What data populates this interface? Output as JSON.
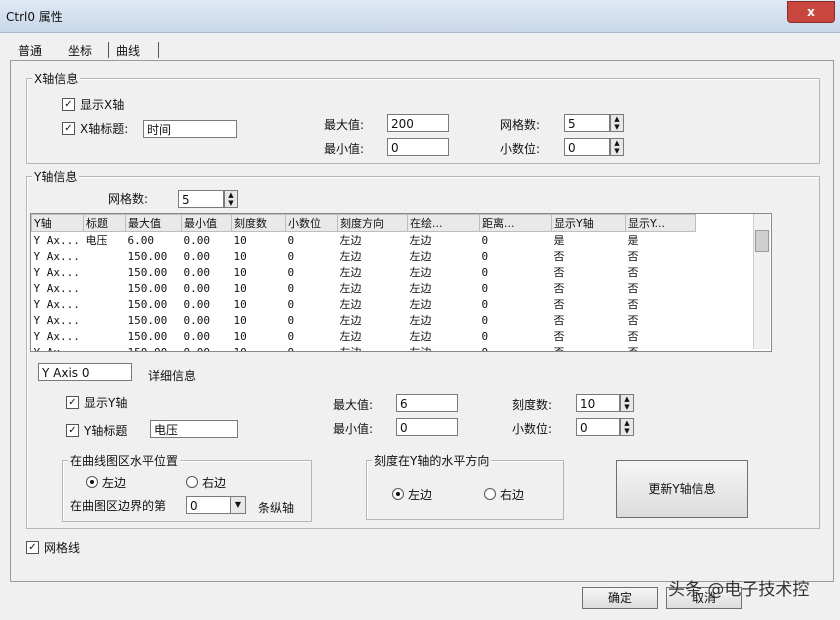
{
  "window": {
    "title": "Ctrl0 属性",
    "close_glyph": "x"
  },
  "tabs": [
    "普通",
    "坐标",
    "曲线"
  ],
  "x_axis": {
    "group_title": "X轴信息",
    "show_label": "显示X轴",
    "title_label": "X轴标题:",
    "title_value": "时间",
    "max_label": "最大值:",
    "max_value": "200",
    "min_label": "最小值:",
    "min_value": "0",
    "grid_label": "网格数:",
    "grid_value": "5",
    "decimals_label": "小数位:",
    "decimals_value": "0"
  },
  "y_axis": {
    "group_title": "Y轴信息",
    "grid_label": "网格数:",
    "grid_value": "5",
    "columns": [
      "Y轴",
      "标题",
      "最大值",
      "最小值",
      "刻度数",
      "小数位",
      "刻度方向",
      "在绘...",
      "距离...",
      "显示Y轴",
      "显示Y..."
    ],
    "rows": [
      [
        "Y Ax...",
        "电压",
        "6.00",
        "0.00",
        "10",
        "0",
        "左边",
        "左边",
        "0",
        "是",
        "是"
      ],
      [
        "Y Ax...",
        "",
        "150.00",
        "0.00",
        "10",
        "0",
        "左边",
        "左边",
        "0",
        "否",
        "否"
      ],
      [
        "Y Ax...",
        "",
        "150.00",
        "0.00",
        "10",
        "0",
        "左边",
        "左边",
        "0",
        "否",
        "否"
      ],
      [
        "Y Ax...",
        "",
        "150.00",
        "0.00",
        "10",
        "0",
        "左边",
        "左边",
        "0",
        "否",
        "否"
      ],
      [
        "Y Ax...",
        "",
        "150.00",
        "0.00",
        "10",
        "0",
        "左边",
        "左边",
        "0",
        "否",
        "否"
      ],
      [
        "Y Ax...",
        "",
        "150.00",
        "0.00",
        "10",
        "0",
        "左边",
        "左边",
        "0",
        "否",
        "否"
      ],
      [
        "Y Ax...",
        "",
        "150.00",
        "0.00",
        "10",
        "0",
        "左边",
        "左边",
        "0",
        "否",
        "否"
      ],
      [
        "Y Ax...",
        "",
        "150.00",
        "0.00",
        "10",
        "0",
        "左边",
        "左边",
        "0",
        "否",
        "否"
      ]
    ]
  },
  "detail": {
    "axis_name": "Y Axis 0",
    "detail_label": "详细信息",
    "show_label": "显示Y轴",
    "title_label": "Y轴标题",
    "title_value": "电压",
    "max_label": "最大值:",
    "max_value": "6",
    "min_label": "最小值:",
    "min_value": "0",
    "ticks_label": "刻度数:",
    "ticks_value": "10",
    "decimals_label": "小数位:",
    "decimals_value": "0",
    "hpos_group": "在曲线图区水平位置",
    "hpos_left": "左边",
    "hpos_right": "右边",
    "border_label": "在曲图区边界的第",
    "border_value": "0",
    "border_suffix": "条纵轴",
    "dir_group": "刻度在Y轴的水平方向",
    "dir_left": "左边",
    "dir_right": "右边",
    "update_button": "更新Y轴信息"
  },
  "gridline_label": "网格线",
  "footer": {
    "ok": "确定",
    "cancel": "取消"
  },
  "watermark": "头条 @电子技术控"
}
